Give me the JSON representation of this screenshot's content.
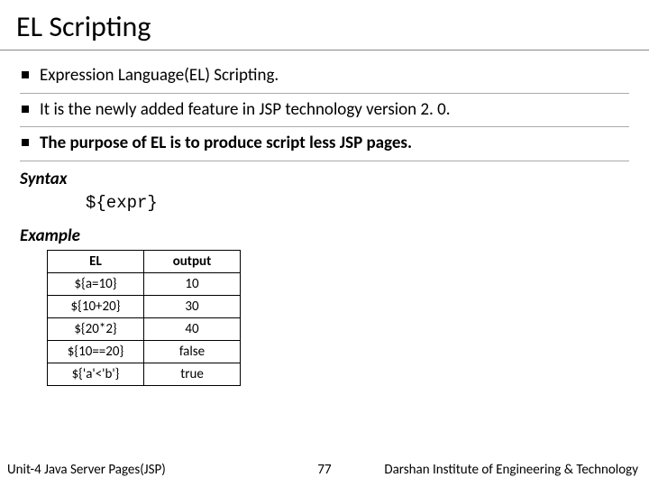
{
  "title": "EL Scripting",
  "bullets": [
    {
      "text": "Expression Language(EL) Scripting.",
      "bold": false
    },
    {
      "text": "It is the newly added feature in JSP technology version 2. 0.",
      "bold": false
    },
    {
      "text": "The purpose of EL is to produce script less JSP pages.",
      "bold": true
    }
  ],
  "syntax": {
    "label": "Syntax",
    "code": "${expr}"
  },
  "example": {
    "label": "Example"
  },
  "table": {
    "headers": [
      "EL",
      "output"
    ],
    "rows": [
      [
        "${a=10}",
        "10"
      ],
      [
        "${10+20}",
        "30"
      ],
      [
        "${20*2}",
        "40"
      ],
      [
        "${10==20}",
        "false"
      ],
      [
        "${'a'<'b'}",
        "true"
      ]
    ]
  },
  "footer": {
    "left": "Unit-4 Java Server Pages(JSP)",
    "page": "77",
    "right": "Darshan Institute of Engineering & Technology"
  },
  "chart_data": {
    "type": "table",
    "headers": [
      "EL",
      "output"
    ],
    "rows": [
      {
        "EL": "${a=10}",
        "output": "10"
      },
      {
        "EL": "${10+20}",
        "output": "30"
      },
      {
        "EL": "${20*2}",
        "output": "40"
      },
      {
        "EL": "${10==20}",
        "output": "false"
      },
      {
        "EL": "${'a'<'b'}",
        "output": "true"
      }
    ]
  }
}
